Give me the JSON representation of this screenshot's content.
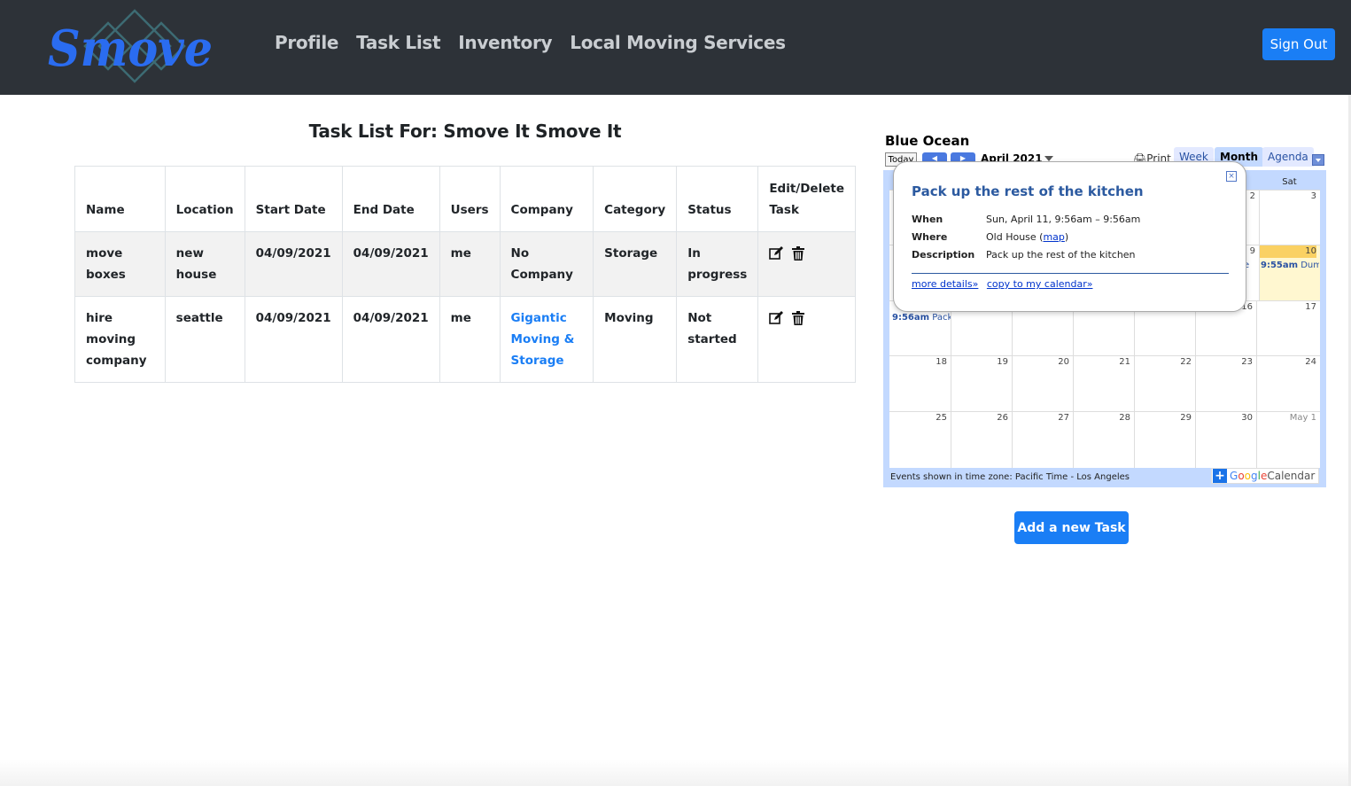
{
  "nav": {
    "logo_text": "Smove",
    "links": [
      "Profile",
      "Task List",
      "Inventory",
      "Local Moving Services"
    ],
    "sign_out": "Sign Out"
  },
  "page": {
    "title": "Task List For: Smove It Smove It"
  },
  "table": {
    "headers": [
      "Name",
      "Location",
      "Start Date",
      "End Date",
      "Users",
      "Company",
      "Category",
      "Status",
      "Edit/Delete Task"
    ],
    "rows": [
      {
        "name": "move boxes",
        "location": "new house",
        "start": "04/09/2021",
        "end": "04/09/2021",
        "users": "me",
        "company": "No Company",
        "category": "Storage",
        "status": "In progress"
      },
      {
        "name": "hire moving company",
        "location": "seattle",
        "start": "04/09/2021",
        "end": "04/09/2021",
        "users": "me",
        "company": "Gigantic Moving & Storage",
        "category": "Moving",
        "status": "Not started"
      }
    ]
  },
  "calendar": {
    "title": "Blue Ocean",
    "today_btn": "Today",
    "month": "April 2021",
    "print": "Print",
    "tabs": [
      "Week",
      "Month",
      "Agenda"
    ],
    "sat_header": "Sat",
    "week1": [
      "2",
      "3"
    ],
    "week2": [
      "9",
      "10"
    ],
    "week3": [
      "16",
      "17"
    ],
    "week4": [
      "18",
      "19",
      "20",
      "21",
      "22",
      "23",
      "24"
    ],
    "week5": [
      "25",
      "26",
      "27",
      "28",
      "29",
      "30",
      "May 1"
    ],
    "events": {
      "fri9": "e",
      "sat10_time": "9:55am",
      "sat10_title": "Dump",
      "sun11_time": "9:56am",
      "sun11_title": "Pack"
    },
    "footer": "Events shown in time zone: Pacific Time - Los Angeles",
    "gcal_plus": "+",
    "gcal_google": [
      "G",
      "o",
      "o",
      "g",
      "l",
      "e"
    ],
    "gcal_calendar": "Calendar"
  },
  "popup": {
    "close": "×",
    "title": "Pack up the rest of the kitchen",
    "when_label": "When",
    "when": "Sun, April 11, 9:56am – 9:56am",
    "where_label": "Where",
    "where": "Old House (",
    "where_map": "map",
    "where_close": ")",
    "desc_label": "Description",
    "desc": "Pack up the rest of the kitchen",
    "more_details": "more details»",
    "copy": "copy to my calendar»"
  },
  "add_task": "Add a new Task",
  "colors": {
    "navbar": "#2d3238",
    "primary": "#1a7ef5",
    "logo": "#2a6cf0"
  }
}
